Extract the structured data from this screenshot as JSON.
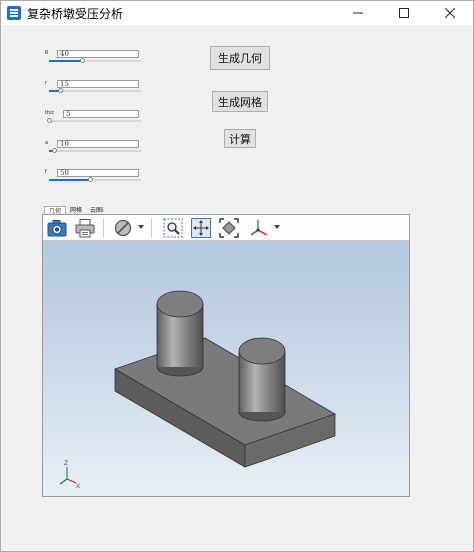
{
  "window": {
    "title": "复杂桥墩受压分析",
    "controls": {
      "minimize": "—",
      "maximize": "☐",
      "close": "✕"
    }
  },
  "params": [
    {
      "label": "R",
      "value": "40",
      "level": 0.36
    },
    {
      "label": "r",
      "value": "15",
      "level": 0.12
    },
    {
      "label": "thic",
      "value": "5",
      "level": 0.0
    },
    {
      "label": "a",
      "value": "10",
      "level": 0.05
    },
    {
      "label": "f",
      "value": "50",
      "level": 0.45
    }
  ],
  "buttons": {
    "generate_geometry": "生成几何",
    "generate_mesh": "生成网格",
    "compute": "计算"
  },
  "tabs": [
    "几何",
    "网格",
    "云图i"
  ],
  "active_tab": 0,
  "colors": {
    "accent": "#1e6fd0",
    "solid": "#7a7a7a",
    "background_top": "#b3c7e0",
    "background_bottom": "#e8eef5"
  },
  "toolbar_icons": [
    "camera-icon",
    "print-icon",
    "hide-icon",
    "hide-dropdown-icon",
    "zoom-window-icon",
    "pan-icon",
    "fit-all-icon",
    "view-axes-icon",
    "view-dropdown-icon"
  ],
  "triad": {
    "z": "Z",
    "x": "X"
  }
}
